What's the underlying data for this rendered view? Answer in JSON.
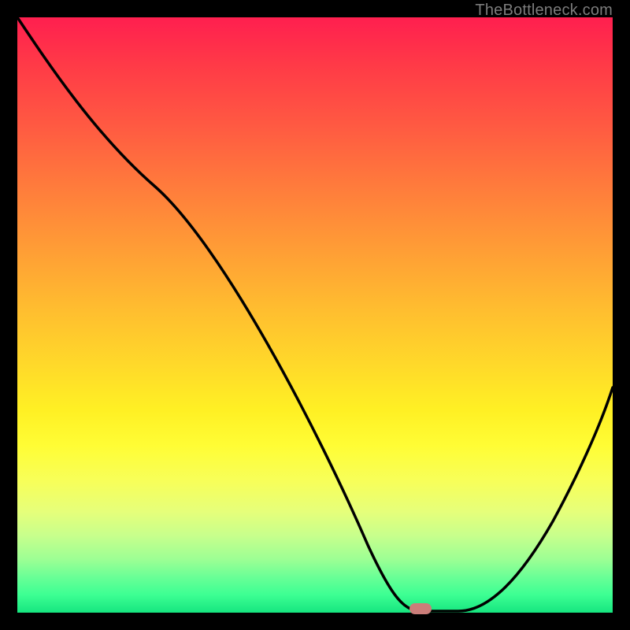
{
  "watermark": "TheBottleneck.com",
  "chart_data": {
    "type": "line",
    "title": "",
    "xlabel": "",
    "ylabel": "",
    "xlim": [
      0,
      100
    ],
    "ylim": [
      0,
      100
    ],
    "series": [
      {
        "name": "bottleneck-curve",
        "x": [
          0,
          6,
          12,
          18,
          24,
          30,
          36,
          42,
          48,
          54,
          60,
          64,
          67,
          70,
          74,
          78,
          82,
          86,
          90,
          94,
          98,
          100
        ],
        "values": [
          100,
          93,
          86,
          78,
          68,
          57,
          47,
          38,
          30,
          22,
          14,
          8,
          4,
          1,
          0,
          0,
          2,
          7,
          14,
          23,
          33,
          38
        ]
      }
    ],
    "marker": {
      "x": 67,
      "y": 0
    },
    "background_gradient": {
      "top": "#ff1f4f",
      "bottom": "#16e57f"
    }
  },
  "colors": {
    "curve": "#000000",
    "marker": "#cb7d79",
    "frame": "#000000"
  }
}
